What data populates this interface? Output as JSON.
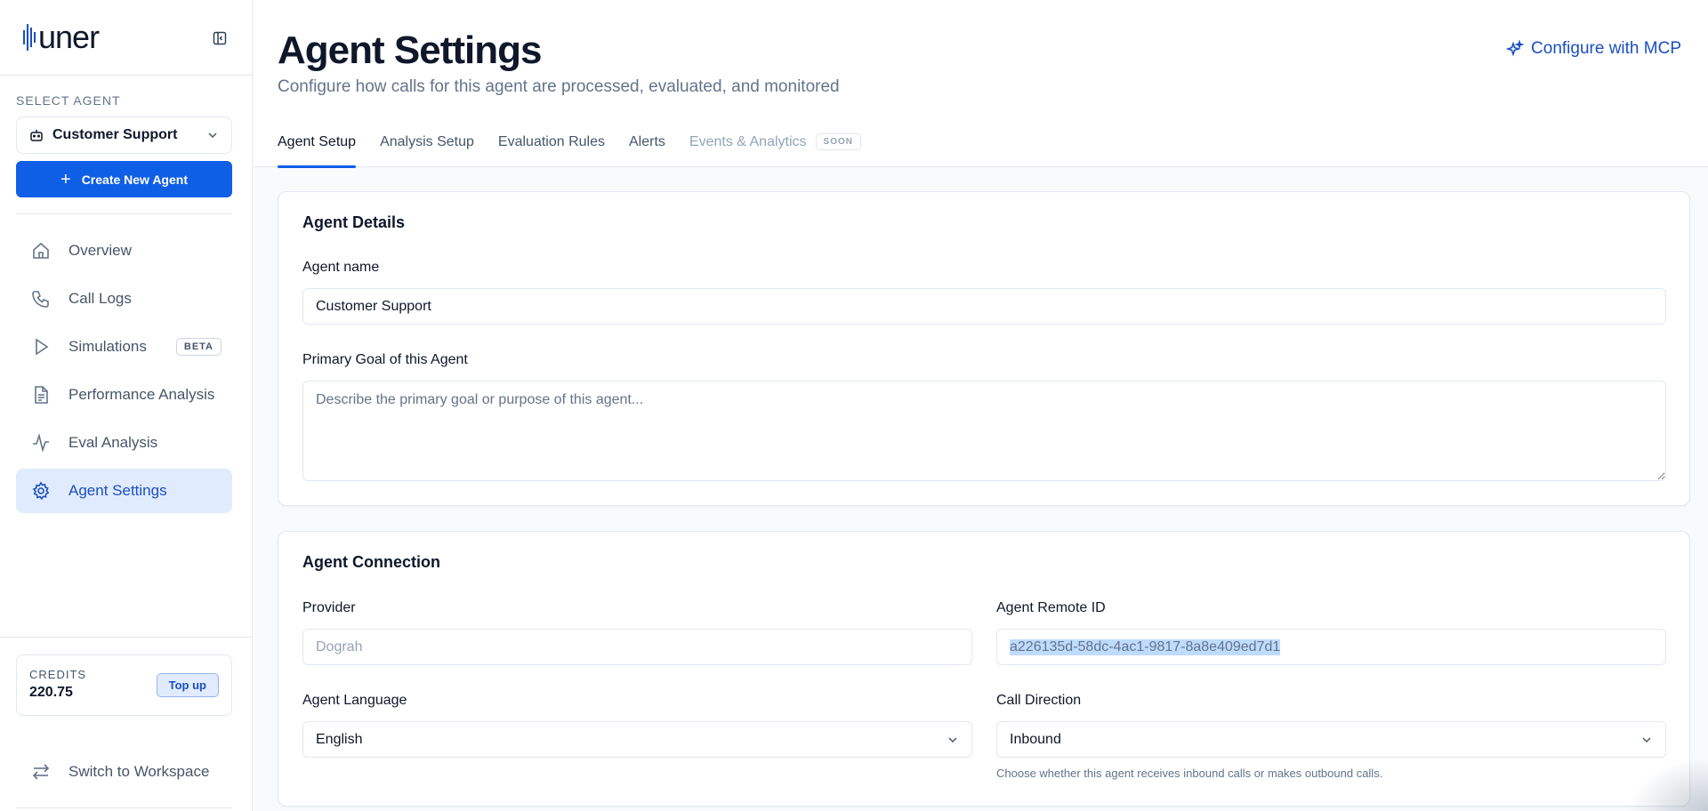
{
  "brand": {
    "logo_text": "uner",
    "accent": "#0f5fe6"
  },
  "sidebar": {
    "select_label": "SELECT AGENT",
    "selected_agent": "Customer Support",
    "create_button": "Create New Agent",
    "items": [
      {
        "label": "Overview",
        "icon": "home-icon"
      },
      {
        "label": "Call Logs",
        "icon": "phone-icon"
      },
      {
        "label": "Simulations",
        "icon": "play-icon",
        "badge": "BETA"
      },
      {
        "label": "Performance Analysis",
        "icon": "document-icon"
      },
      {
        "label": "Eval Analysis",
        "icon": "activity-icon"
      },
      {
        "label": "Agent Settings",
        "icon": "gear-icon",
        "active": true
      }
    ],
    "credits": {
      "label": "CREDITS",
      "value": "220.75",
      "topup_label": "Top up"
    },
    "switch_label": "Switch to Workspace"
  },
  "header": {
    "title": "Agent Settings",
    "subtitle": "Configure how calls for this agent are processed, evaluated, and monitored",
    "mcp_button": "Configure with MCP",
    "tabs": [
      {
        "label": "Agent Setup",
        "active": true
      },
      {
        "label": "Analysis Setup"
      },
      {
        "label": "Evaluation Rules"
      },
      {
        "label": "Alerts"
      },
      {
        "label": "Events & Analytics",
        "disabled": true,
        "badge": "SOON"
      }
    ]
  },
  "agent_details": {
    "title": "Agent Details",
    "name_label": "Agent name",
    "name_value": "Customer Support",
    "goal_label": "Primary Goal of this Agent",
    "goal_placeholder": "Describe the primary goal or purpose of this agent..."
  },
  "agent_connection": {
    "title": "Agent Connection",
    "provider_label": "Provider",
    "provider_value": "Dograh",
    "remote_id_label": "Agent Remote ID",
    "remote_id_value": "a226135d-58dc-4ac1-9817-8a8e409ed7d1",
    "language_label": "Agent Language",
    "language_value": "English",
    "direction_label": "Call Direction",
    "direction_value": "Inbound",
    "direction_hint": "Choose whether this agent receives inbound calls or makes outbound calls."
  }
}
